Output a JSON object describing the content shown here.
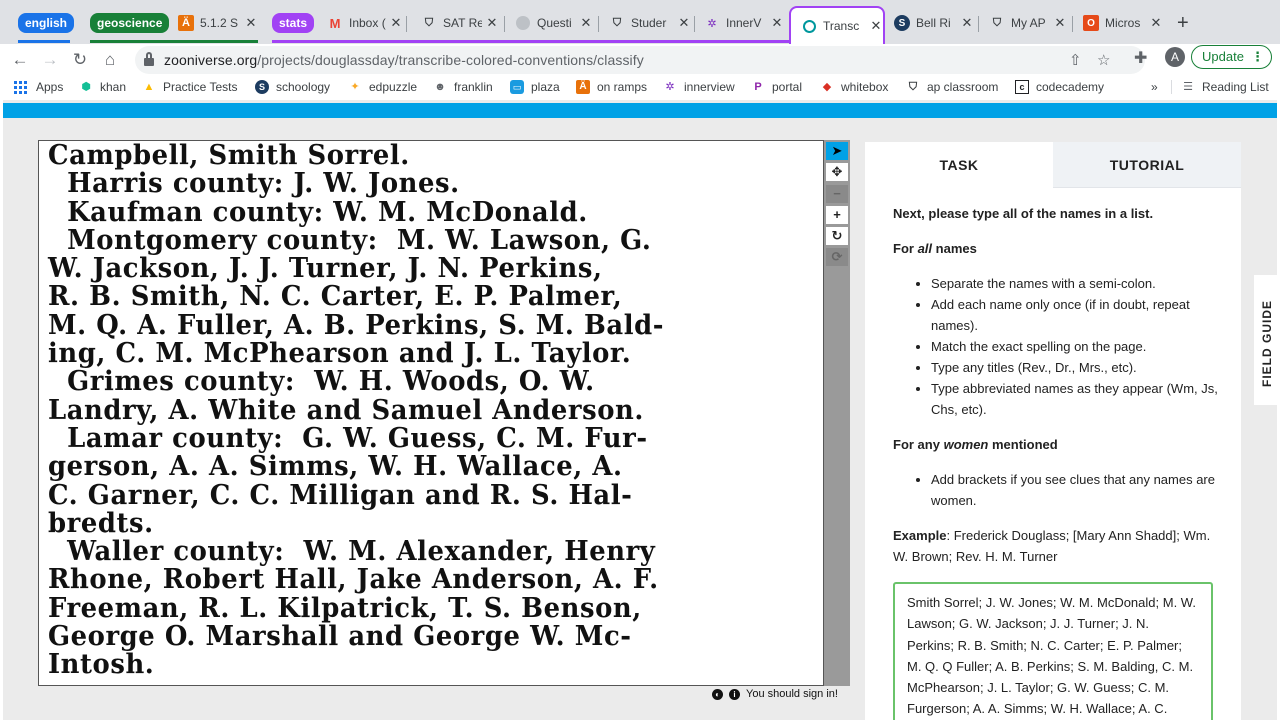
{
  "browser": {
    "groups": [
      {
        "label": "english",
        "color": "#1a73e8"
      },
      {
        "label": "geoscience",
        "color": "#188038"
      },
      {
        "label": "stats",
        "color": "#a142f4"
      }
    ],
    "tabs": [
      {
        "label": "5.1.2 S",
        "icon": "orange-hat-icon"
      },
      {
        "label": "Inbox (",
        "icon": "gmail-icon"
      },
      {
        "label": "SAT Re",
        "icon": "shield-icon"
      },
      {
        "label": "Questi",
        "icon": "gray-circle-icon"
      },
      {
        "label": "Studer",
        "icon": "shield-icon"
      },
      {
        "label": "InnerV",
        "icon": "innerview-icon"
      },
      {
        "label": "Transc",
        "icon": "zooniverse-icon"
      },
      {
        "label": "Bell Ri",
        "icon": "schoology-icon"
      },
      {
        "label": "My AP",
        "icon": "shield-icon"
      },
      {
        "label": "Micros",
        "icon": "office-icon"
      }
    ],
    "url_host": "zooniverse.org",
    "url_path": "/projects/douglassday/transcribe-colored-conventions/classify",
    "avatar": "A",
    "update_label": "Update",
    "bookmarks": [
      {
        "label": "Apps",
        "icon": "apps-grid-icon"
      },
      {
        "label": "khan",
        "icon": "khan-icon"
      },
      {
        "label": "Practice Tests",
        "icon": "drive-icon"
      },
      {
        "label": "schoology",
        "icon": "schoology-icon"
      },
      {
        "label": "edpuzzle",
        "icon": "edpuzzle-icon"
      },
      {
        "label": "franklin",
        "icon": "franklin-icon"
      },
      {
        "label": "plaza",
        "icon": "plaza-icon"
      },
      {
        "label": "on ramps",
        "icon": "orange-hat-icon"
      },
      {
        "label": "innerview",
        "icon": "innerview-icon"
      },
      {
        "label": "portal",
        "icon": "portal-icon"
      },
      {
        "label": "whitebox",
        "icon": "whitebox-icon"
      },
      {
        "label": "ap classroom",
        "icon": "shield-icon"
      },
      {
        "label": "codecademy",
        "icon": "codecademy-icon"
      }
    ],
    "reading_list": "Reading List",
    "more": "»"
  },
  "subject": {
    "lines": [
      "Campbell, Smith Sorrel.",
      "  Harris county: J. W. Jones.",
      "  Kaufman county: W. M. McDonald.",
      "  Montgomery county:  M. W. Lawson, G.",
      "W. Jackson, J. J. Turner, J. N. Perkins,",
      "R. B. Smith, N. C. Carter, E. P. Palmer,",
      "M. Q. A. Fuller, A. B. Perkins, S. M. Bald-",
      "ing, C. M. McPhearson and J. L. Taylor.",
      "  Grimes county:  W. H. Woods, O. W.",
      "Landry, A. White and Samuel Anderson.",
      "  Lamar county:  G. W. Guess, C. M. Fur-",
      "gerson, A. A. Simms, W. H. Wallace, A.",
      "C. Garner, C. C. Milligan and R. S. Hal-",
      "bredts.",
      "  Waller county:  W. M. Alexander, Henry",
      "Rhone, Robert Hall, Jake Anderson, A. F.",
      "Freeman, R. L. Kilpatrick, T. S. Benson,",
      "George O. Marshall and George W. Mc-",
      "Intosh."
    ],
    "sign_in": "You should sign in!"
  },
  "panel": {
    "tab_task": "TASK",
    "tab_tutorial": "TUTORIAL",
    "heading": "Next, please type all of the names in a list.",
    "for_all_prefix": "For ",
    "for_all_em": "all",
    "for_all_suffix": " names",
    "all_rules": [
      "Separate the names with a semi-colon.",
      "Add each name only once (if in doubt, repeat names).",
      "Match the exact spelling on the page.",
      "Type any titles (Rev., Dr., Mrs., etc).",
      "Type abbreviated names as they appear (Wm, Js, Chs, etc)."
    ],
    "for_women_prefix": "For any ",
    "for_women_em": "women",
    "for_women_suffix": " mentioned",
    "women_rules": [
      "Add brackets if you see clues that any names are women."
    ],
    "example_label": "Example",
    "example_text": ": Frederick Douglass; [Mary Ann Shadd]; Wm. W. Brown; Rev. H. M. Turner",
    "answer": "Smith Sorrel; J. W. Jones; W. M. McDonald; M. W. Lawson; G. W. Jackson; J. J. Turner; J. N. Perkins; R. B. Smith; N. C. Carter; E. P. Palmer; M. Q. Q Fuller; A. B. Perkins; S. M. Balding, C. M. McPhearson; J. L. Taylor; G. W. Guess; C. M. Furgerson; A. A. Simms; W. H. Wallace; A. C.",
    "field_guide": "FIELD GUIDE"
  }
}
